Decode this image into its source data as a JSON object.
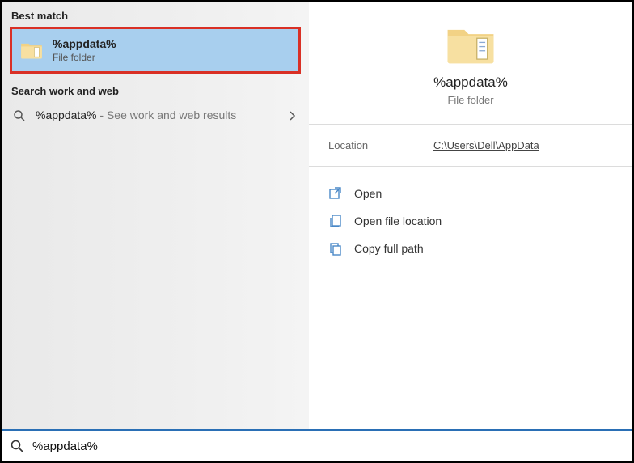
{
  "section_labels": {
    "best_match": "Best match",
    "search_web": "Search work and web"
  },
  "best_match": {
    "title": "%appdata%",
    "subtitle": "File folder"
  },
  "web_result": {
    "query": "%appdata%",
    "hint": " - See work and web results"
  },
  "detail": {
    "title": "%appdata%",
    "subtitle": "File folder",
    "location_label": "Location",
    "location_value": "C:\\Users\\Dell\\AppData"
  },
  "actions": {
    "open": "Open",
    "open_location": "Open file location",
    "copy_path": "Copy full path"
  },
  "search": {
    "value": "%appdata%"
  }
}
